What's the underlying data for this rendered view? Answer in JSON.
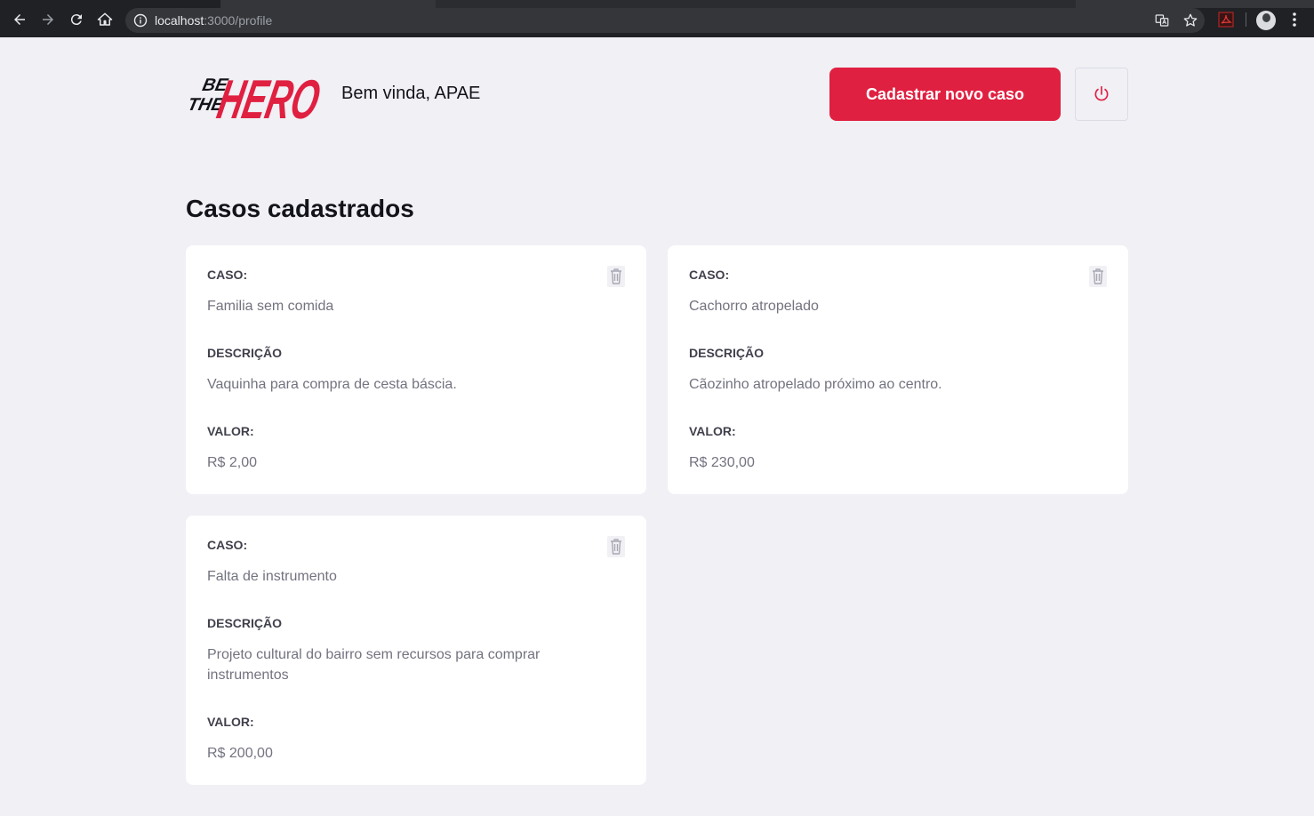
{
  "browser": {
    "url_host": "localhost",
    "url_rest": ":3000/profile"
  },
  "header": {
    "logo_text_small_1": "BE",
    "logo_text_small_2": "THE",
    "logo_text_big": "HERO",
    "welcome": "Bem vinda, APAE",
    "new_case_button": "Cadastrar novo caso"
  },
  "page_title": "Casos cadastrados",
  "labels": {
    "case": "CASO:",
    "description": "DESCRIÇÃO",
    "value": "VALOR:"
  },
  "cases": [
    {
      "title": "Familia sem comida",
      "description": "Vaquinha para compra de cesta báscia.",
      "value": "R$ 2,00"
    },
    {
      "title": "Cachorro atropelado",
      "description": "Cãozinho atropelado próximo ao centro.",
      "value": "R$ 230,00"
    },
    {
      "title": "Falta de instrumento",
      "description": "Projeto cultural do bairro sem recursos para comprar instrumentos",
      "value": "R$ 200,00"
    }
  ],
  "colors": {
    "accent": "#e02041",
    "background": "#f0f0f5",
    "card": "#ffffff",
    "label": "#41414d",
    "value_text": "#737380"
  },
  "icons": {
    "back": "arrow-left-icon",
    "forward": "arrow-right-icon",
    "reload": "reload-icon",
    "home": "home-icon",
    "site_info": "info-icon",
    "translate": "translate-icon",
    "bookmark": "star-icon",
    "extension": "pdf-extension-icon",
    "profile": "avatar-icon",
    "menu": "kebab-menu-icon",
    "logout": "power-icon",
    "delete": "trash-icon"
  }
}
